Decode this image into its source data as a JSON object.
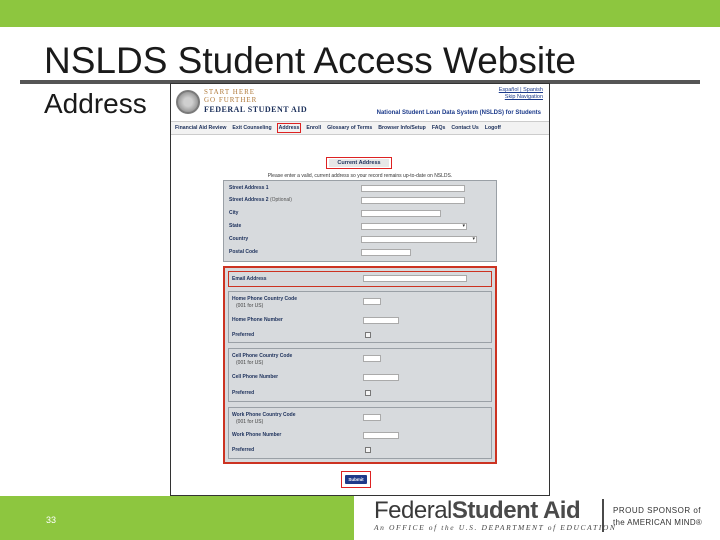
{
  "slide": {
    "title": "NSLDS Student Access Website",
    "subtitle": "Address",
    "number": "33",
    "colors": {
      "accent": "#8dc63f",
      "highlight": "#cc2222",
      "link": "#1b3a8a"
    }
  },
  "site": {
    "logo_line1": "START HERE",
    "logo_line2": "GO FURTHER",
    "logo_line3": "FEDERAL STUDENT AID",
    "seal_icon": "department-seal-icon",
    "link_spanish": "Español | Spanish",
    "link_skip": "Skip Navigation",
    "system_title": "National Student Loan Data System (NSLDS) for Students",
    "nav": [
      {
        "label": "Financial Aid Review",
        "active": false
      },
      {
        "label": "Exit Counseling",
        "active": false
      },
      {
        "label": "Address",
        "active": true
      },
      {
        "label": "Enroll",
        "active": false
      },
      {
        "label": "Glossary of Terms",
        "active": false
      },
      {
        "label": "Browser Info/Setup",
        "active": false
      },
      {
        "label": "FAQs",
        "active": false
      },
      {
        "label": "Contact Us",
        "active": false
      },
      {
        "label": "Logoff",
        "active": false
      }
    ],
    "page_heading": "Current Address",
    "instructions": "Please enter a valid, current address so your record remains up-to-date on NSLDS.",
    "address": {
      "street1": "Street Address 1",
      "street2": "Street Address 2",
      "street2_optional": "(Optional)",
      "city": "City",
      "state": "State",
      "country": "Country",
      "postal": "Postal Code"
    },
    "contact": {
      "email": "Email Address",
      "home_country_code": "Home Phone Country Code",
      "home_hint": "(001 for US)",
      "home_number": "Home Phone Number",
      "home_preferred": "Preferred",
      "cell_country_code": "Cell Phone Country Code",
      "cell_hint": "(001 for US)",
      "cell_number": "Cell Phone Number",
      "cell_preferred": "Preferred",
      "work_country_code": "Work Phone Country Code",
      "work_hint": "(001 for US)",
      "work_number": "Work Phone Number",
      "work_preferred": "Preferred"
    },
    "submit_label": "Submit"
  },
  "footer": {
    "brand_part1": "Federal",
    "brand_part2": "Student Aid",
    "tagline": "An OFFICE of the U.S. DEPARTMENT of EDUCATION",
    "sponsor_line1": "PROUD SPONSOR of",
    "sponsor_line2": "the AMERICAN MIND®"
  }
}
